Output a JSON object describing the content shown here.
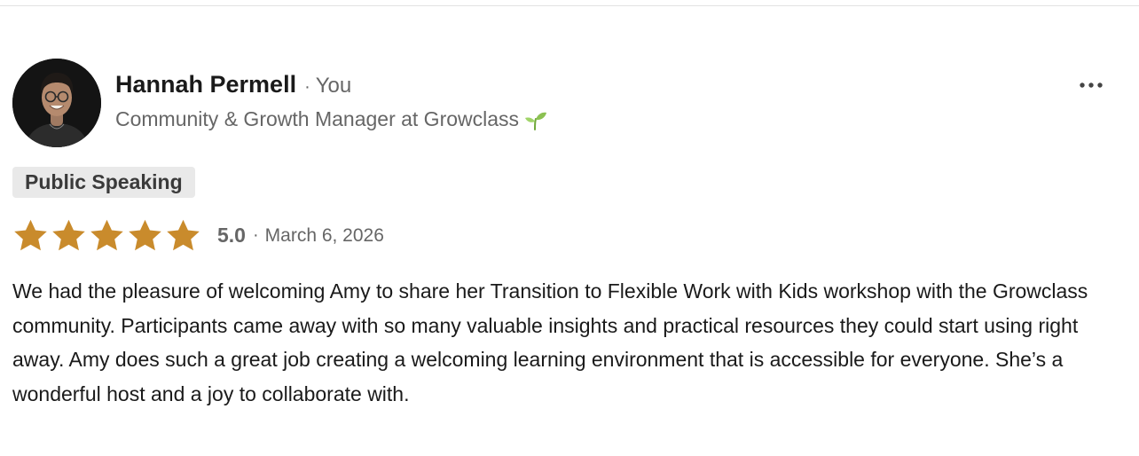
{
  "reviewer": {
    "name": "Hannah Permell",
    "separator": "·",
    "relation": "You",
    "headline": "Community & Growth Manager at Growclass",
    "headline_icon": "sprout-icon",
    "avatar_icon": "profile-photo"
  },
  "menu": {
    "icon": "more-horizontal-icon"
  },
  "tag": {
    "label": "Public Speaking"
  },
  "rating": {
    "stars": 5,
    "max_stars": 5,
    "star_color": "#c98b2c",
    "score": "5.0",
    "separator": "·",
    "date": "March 6, 2026"
  },
  "review": {
    "text": "We had the pleasure of welcoming Amy to share her Transition to Flexible Work with Kids workshop with the Growclass community. Participants came away with so many valuable insights and practical resources they could start using right away. Amy does such a great job creating a welcoming learning environment that is accessible for everyone. She’s a wonderful host and a joy to collaborate with."
  }
}
